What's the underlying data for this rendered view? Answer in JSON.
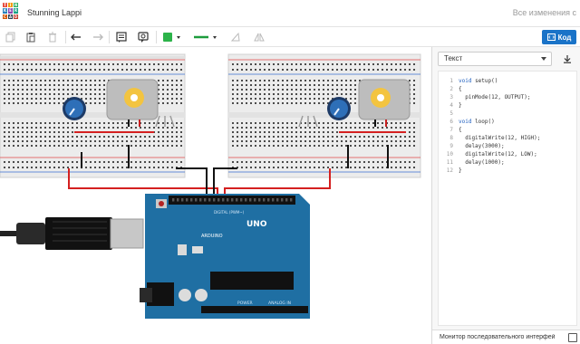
{
  "header": {
    "design_title": "Stunning Lappi",
    "save_status": "Все изменения с",
    "logo_letters": [
      "T",
      "I",
      "N",
      "K",
      "E",
      "R",
      "C",
      "A",
      "D"
    ],
    "logo_colors": [
      "#e74c3c",
      "#f39c12",
      "#27ae60",
      "#2980b9",
      "#8e44ad",
      "#16a085",
      "#d35400",
      "#2c3e50",
      "#c0392b"
    ]
  },
  "toolbar": {
    "icons": [
      "copy-icon",
      "paste-icon",
      "trash-icon",
      "undo-icon",
      "redo-icon",
      "note-icon",
      "comment-toggle-icon",
      "color-swatch",
      "wire-style"
    ],
    "fill_color": "#2cb34a",
    "wire_color": "#1d9c3c",
    "code_button_label": "Код"
  },
  "code_panel": {
    "mode_label": "Текст",
    "lines": [
      {
        "n": "1",
        "text": "void setup()"
      },
      {
        "n": "2",
        "text": "{"
      },
      {
        "n": "3",
        "text": "  pinMode(12, OUTPUT);"
      },
      {
        "n": "4",
        "text": "}"
      },
      {
        "n": "5",
        "text": ""
      },
      {
        "n": "6",
        "text": "void loop()"
      },
      {
        "n": "7",
        "text": "{"
      },
      {
        "n": "8",
        "text": "  digitalWrite(12, HIGH);"
      },
      {
        "n": "9",
        "text": "  delay(3000);"
      },
      {
        "n": "10",
        "text": "  digitalWrite(12, LOW);"
      },
      {
        "n": "11",
        "text": "  delay(1000);"
      },
      {
        "n": "12",
        "text": "}"
      }
    ],
    "serial_monitor_label": "Монитор последовательного интерфейса"
  },
  "board": {
    "brand": "ARDUINO",
    "model": "UNO",
    "digital_label": "DIGITAL (PWM~)",
    "power_label": "POWER",
    "analog_label": "ANALOG IN",
    "accent": "#1f6fa3"
  }
}
